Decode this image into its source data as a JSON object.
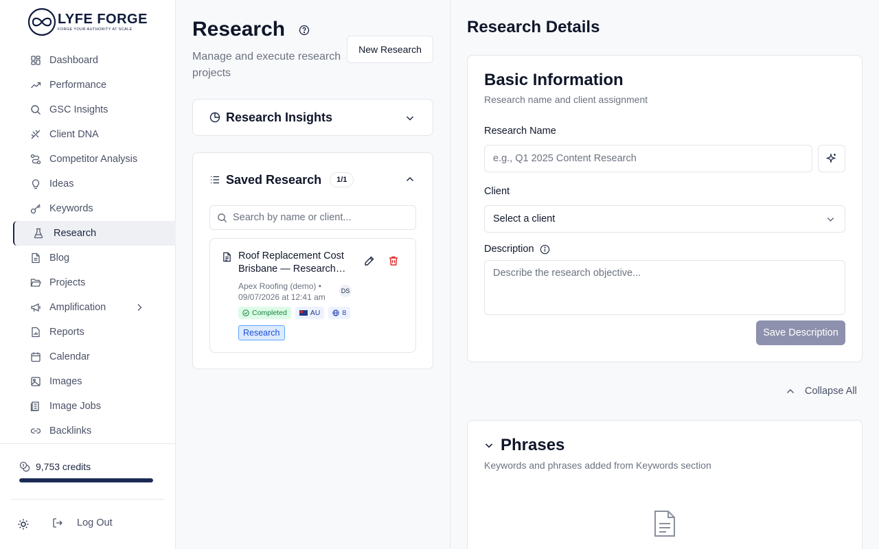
{
  "brand": {
    "name": "LYFE FORGE",
    "tagline": "FORGE YOUR AUTHORITY AT SCALE"
  },
  "sidebar": {
    "items": [
      {
        "label": "Dashboard",
        "icon": "dashboard-icon"
      },
      {
        "label": "Performance",
        "icon": "trending-up-icon"
      },
      {
        "label": "GSC Insights",
        "icon": "search-icon"
      },
      {
        "label": "Client DNA",
        "icon": "dna-icon"
      },
      {
        "label": "Competitor Analysis",
        "icon": "route-icon"
      },
      {
        "label": "Ideas",
        "icon": "lightbulb-icon"
      },
      {
        "label": "Keywords",
        "icon": "key-icon"
      },
      {
        "label": "Research",
        "icon": "flask-icon",
        "active": true
      },
      {
        "label": "Blog",
        "icon": "document-icon"
      },
      {
        "label": "Projects",
        "icon": "folder-open-icon"
      },
      {
        "label": "Amplification",
        "icon": "megaphone-icon",
        "has_submenu": true
      },
      {
        "label": "Reports",
        "icon": "report-icon"
      },
      {
        "label": "Calendar",
        "icon": "calendar-icon"
      },
      {
        "label": "Images",
        "icon": "image-icon"
      },
      {
        "label": "Image Jobs",
        "icon": "image-jobs-icon"
      },
      {
        "label": "Backlinks",
        "icon": "link-icon"
      }
    ],
    "credits": {
      "label": "9,753 credits",
      "level": 1.0
    },
    "logout_label": "Log Out"
  },
  "research": {
    "title": "Research",
    "subtitle": "Manage and execute research projects",
    "new_button": "New Research",
    "insights_title": "Research Insights",
    "saved": {
      "title": "Saved Research",
      "count": "1/1",
      "search_placeholder": "Search by name or client...",
      "items": [
        {
          "title_line1": "Roof Replacement Cost",
          "title_line2": "Brisbane — Research…",
          "client_line": "Apex Roofing (demo) •",
          "date_line": "09/07/2026 at 12:41 am",
          "avatar": "DS",
          "status": "Completed",
          "country": "AU",
          "sites": "8",
          "type": "Research"
        }
      ]
    }
  },
  "details": {
    "title": "Research Details",
    "basic": {
      "title": "Basic Information",
      "subtitle": "Research name and client assignment",
      "name_label": "Research Name",
      "name_placeholder": "e.g., Q1 2025 Content Research",
      "client_label": "Client",
      "client_value": "Select a client",
      "description_label": "Description",
      "description_placeholder": "Describe the research objective...",
      "save_button": "Save Description"
    },
    "collapse_all": "Collapse All",
    "phrases": {
      "title": "Phrases",
      "subtitle": "Keywords and phrases added from Keywords section"
    }
  },
  "colors": {
    "brand": "#0f1b3d",
    "accent_disabled": "#8e91ad",
    "success": "#15803d",
    "danger": "#dc2626",
    "tag_blue": "#1d4ed8"
  }
}
